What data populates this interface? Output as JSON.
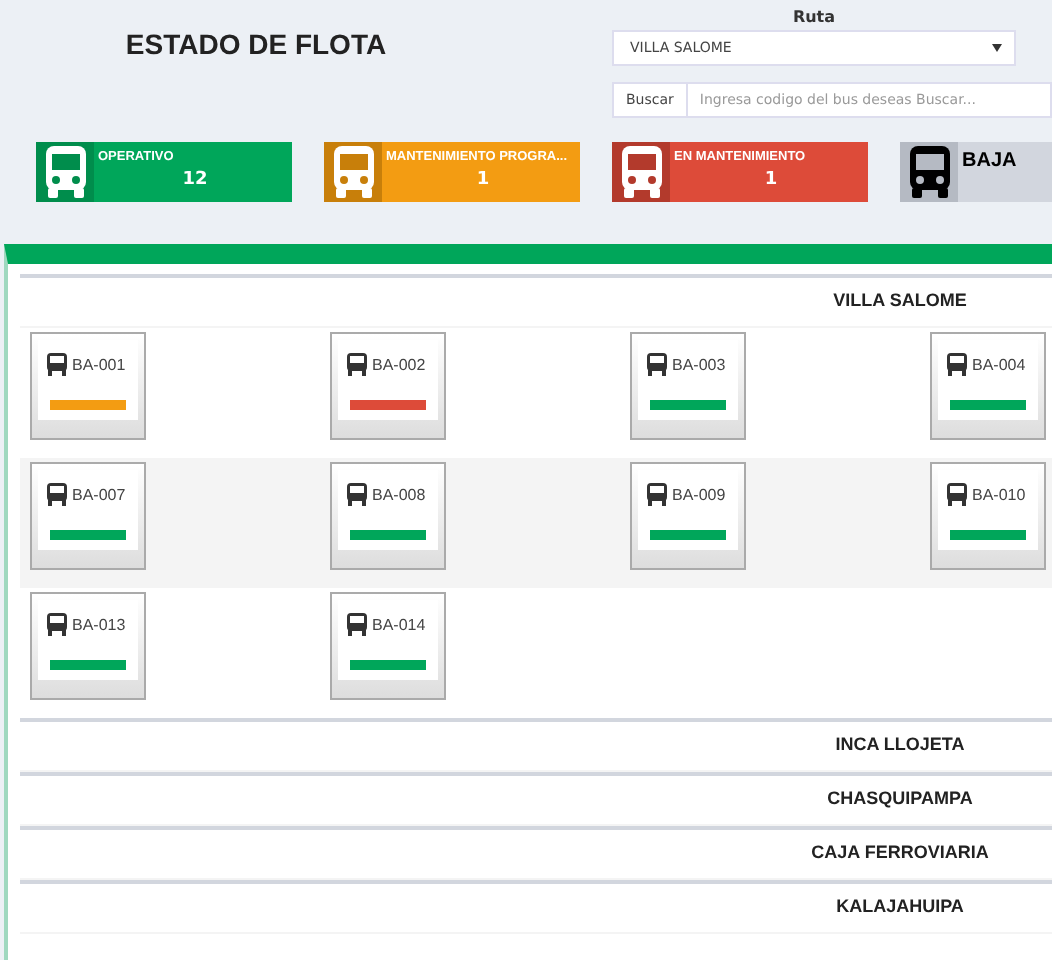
{
  "header": {
    "title": "ESTADO DE FLOTA",
    "route_label": "Ruta",
    "route_value": "VILLA SALOME",
    "search_button": "Buscar",
    "search_placeholder": "Ingresa codigo del bus deseas Buscar..."
  },
  "stats": [
    {
      "kind": "operativo",
      "label": "OPERATIVO",
      "count": "12",
      "color": "#00a65a"
    },
    {
      "kind": "programado",
      "label": "MANTENIMIENTO PROGRA...",
      "count": "1",
      "color": "#f39c12"
    },
    {
      "kind": "mantenimiento",
      "label": "EN MANTENIMIENTO",
      "count": "1",
      "color": "#dd4b39"
    },
    {
      "kind": "baja",
      "label": "BAJA",
      "color": "#d2d6de"
    }
  ],
  "groups": [
    {
      "name": "VILLA SALOME",
      "buses": [
        {
          "code": "BA-001",
          "color": "#f39c12"
        },
        {
          "code": "BA-002",
          "color": "#dd4b39"
        },
        {
          "code": "BA-003",
          "color": "#00a65a"
        },
        {
          "code": "BA-004",
          "color": "#00a65a"
        },
        {
          "code": "BA-007",
          "color": "#00a65a"
        },
        {
          "code": "BA-008",
          "color": "#00a65a"
        },
        {
          "code": "BA-009",
          "color": "#00a65a"
        },
        {
          "code": "BA-010",
          "color": "#00a65a"
        },
        {
          "code": "BA-013",
          "color": "#00a65a"
        },
        {
          "code": "BA-014",
          "color": "#00a65a"
        }
      ]
    },
    {
      "name": "INCA LLOJETA"
    },
    {
      "name": "CHASQUIPAMPA"
    },
    {
      "name": "CAJA FERROVIARIA"
    },
    {
      "name": "KALAJAHUIPA"
    }
  ]
}
